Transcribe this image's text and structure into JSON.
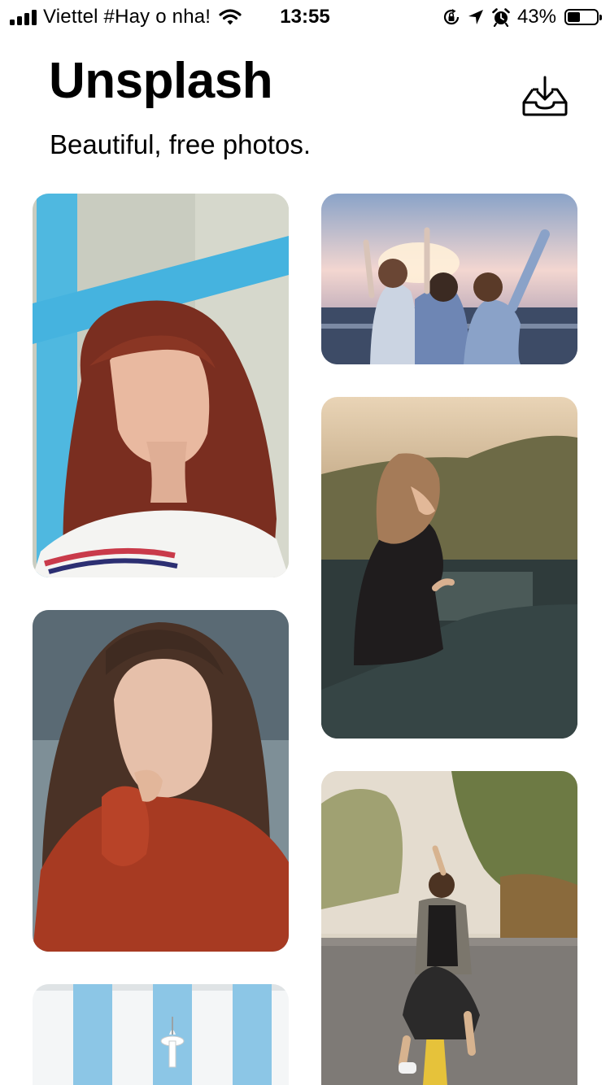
{
  "status_bar": {
    "carrier": "Viettel #Hay o nha!",
    "time": "13:55",
    "battery_percent": "43%",
    "battery_level": 0.43,
    "icons": [
      "signal-icon",
      "wifi-icon",
      "orientation-lock-icon",
      "location-icon",
      "alarm-icon",
      "battery-icon"
    ]
  },
  "header": {
    "title": "Unsplash",
    "subtitle": "Beautiful, free photos.",
    "download_icon": "inbox-download-icon"
  },
  "photos": [
    {
      "subject": "woman-red-hair-blue-wall"
    },
    {
      "subject": "friends-sunset-raised-arms"
    },
    {
      "subject": "woman-sitting-sunset-bridge"
    },
    {
      "subject": "woman-red-jacket-portrait"
    },
    {
      "subject": "woman-crouching-street"
    },
    {
      "subject": "blue-white-striped-building"
    }
  ]
}
